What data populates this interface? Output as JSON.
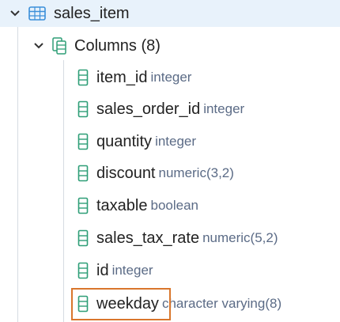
{
  "tree": {
    "table": {
      "name": "sales_item",
      "expanded": true,
      "icon": "table-icon"
    },
    "columns_node": {
      "label": "Columns (8)",
      "expanded": true,
      "icon": "columns-icon"
    },
    "columns": [
      {
        "name": "item_id",
        "type": "integer"
      },
      {
        "name": "sales_order_id",
        "type": "integer"
      },
      {
        "name": "quantity",
        "type": "integer"
      },
      {
        "name": "discount",
        "type": "numeric(3,2)"
      },
      {
        "name": "taxable",
        "type": "boolean"
      },
      {
        "name": "sales_tax_rate",
        "type": "numeric(5,2)"
      },
      {
        "name": "id",
        "type": "integer"
      },
      {
        "name": "weekday",
        "type": "character varying(8)"
      }
    ],
    "highlighted_column": "weekday"
  },
  "colors": {
    "selected_row_bg": "#e8f2fb",
    "icon_green": "#2e9e77",
    "table_icon_blue": "#3a8fd9",
    "type_text": "#5b6b86",
    "highlight_border": "#d9762c"
  }
}
